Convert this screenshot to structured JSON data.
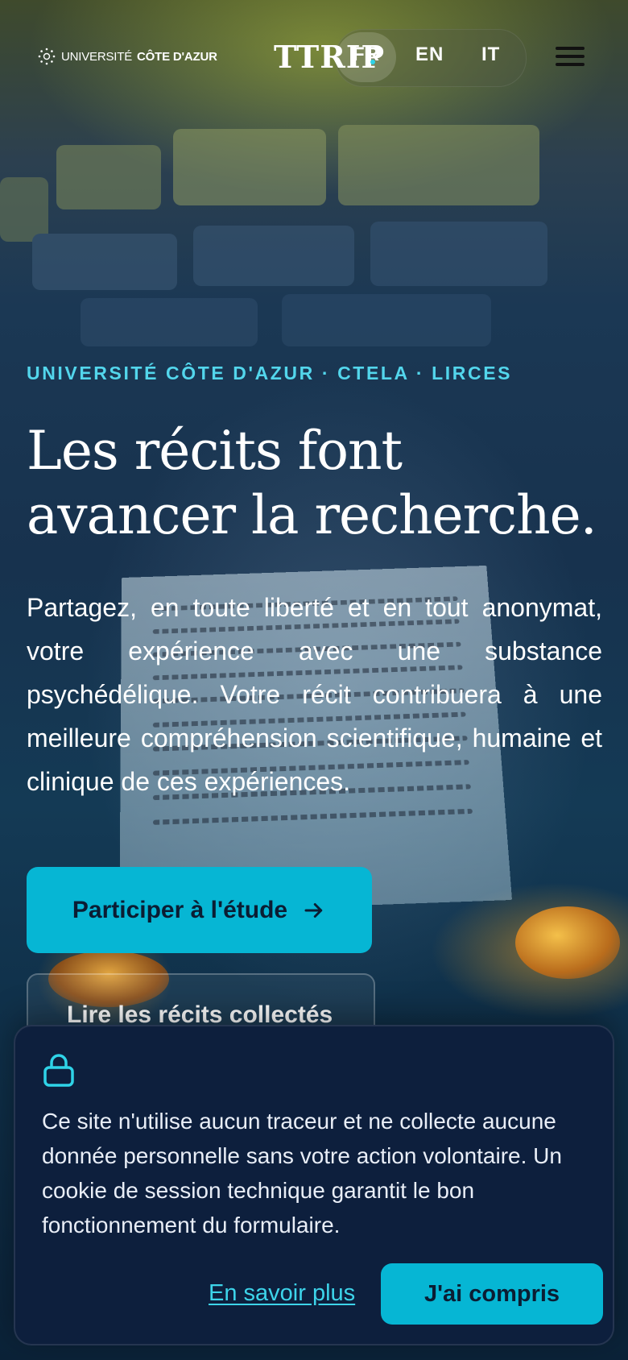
{
  "header": {
    "university_logo": {
      "prefix": "UNIVERSITÉ",
      "name": "CÔTE D'AZUR"
    },
    "brand": "TTRIP",
    "languages": [
      {
        "code": "FR",
        "active": true
      },
      {
        "code": "EN",
        "active": false
      },
      {
        "code": "IT",
        "active": false
      }
    ],
    "menu_icon": "hamburger-icon"
  },
  "hero": {
    "eyebrow": "UNIVERSITÉ CÔTE D'AZUR · CTELA · LIRCES",
    "title": "Les récits font avancer la recherche.",
    "text": "Partagez, en toute liberté et en tout anonymat, votre expérience avec une substance psychédélique. Votre récit contribuera à une meilleure compréhension scientifique, humaine et clinique de ces expériences.",
    "primary_button": "Participer à l'étude",
    "primary_button_icon": "arrow-right-icon",
    "secondary_button": "Lire les récits collectés"
  },
  "cookie_banner": {
    "icon": "lock-icon",
    "text": "Ce site n'utilise aucun traceur et ne collecte aucune donnée personnelle sans votre action volontaire. Un cookie de session technique garantit le bon fonctionnement du formulaire.",
    "learn_more": "En savoir plus",
    "accept": "J'ai compris"
  },
  "colors": {
    "accent": "#06b6d4",
    "eyebrow": "#53d6ec",
    "banner_bg": "#0d1f3d"
  }
}
